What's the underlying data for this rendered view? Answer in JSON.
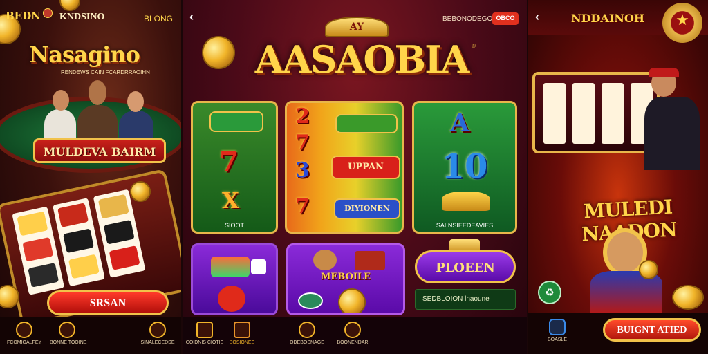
{
  "panel_left": {
    "logo": "BEDN",
    "brand": "KNDSINO",
    "link": "BLONG",
    "title": "Nasagino",
    "subtitle": "RENDEWS CAIN FCARDRRAOIHN",
    "banner": "MULDEVA BAIRM",
    "spin_button": "SRSAN",
    "nav": [
      {
        "label": "FCOMIOALFEY",
        "icon": "home-icon"
      },
      {
        "label": "BONNE TOOINE",
        "icon": "gift-icon"
      },
      {
        "label": "SINALECEDSE",
        "icon": "wallet-icon"
      }
    ]
  },
  "panel_middle": {
    "promo_text": "BEBONODEGOES",
    "top_button": "OBCO",
    "crown_text": "AY",
    "title": "AASAOBIA",
    "tiles": {
      "slots_label": "SIOOT",
      "reels_badge_top": "UPPAN",
      "reels_badge_bottom": "DIYIONEN",
      "big_number": "10",
      "promo_label": "SALNSIEEDEAVIES",
      "bonus_badge": "PLOEEN",
      "bonus_caption": "SEDBLOION lnaoune",
      "game_badge": "MEBOILE"
    },
    "nav": [
      {
        "label": "COIDNIS CIOTIE",
        "icon": "chat-icon"
      },
      {
        "label": "BOSIONEE",
        "icon": "gift-icon"
      },
      {
        "label": "ODEBOSNAGE",
        "icon": "search-icon"
      },
      {
        "label": "BOONENDAR",
        "icon": "profile-icon"
      }
    ]
  },
  "panel_right": {
    "brand": "NDDAINOH",
    "title": "MULEDI NAADON",
    "nav_label": "BOASLE",
    "cta_button": "BUIGNT ATIED"
  }
}
